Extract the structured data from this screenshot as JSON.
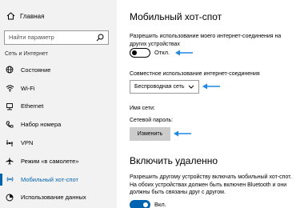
{
  "sidebar": {
    "home_label": "Главная",
    "search_placeholder": "Найти параметр",
    "section_title": "Сеть и Интернет",
    "items": [
      {
        "label": "Состояние",
        "icon": "globe-icon"
      },
      {
        "label": "Wi-Fi",
        "icon": "wifi-icon"
      },
      {
        "label": "Ethernet",
        "icon": "ethernet-icon"
      },
      {
        "label": "Набор номера",
        "icon": "phone-icon"
      },
      {
        "label": "VPN",
        "icon": "vpn-icon"
      },
      {
        "label": "Режим «в самолете»",
        "icon": "airplane-icon"
      },
      {
        "label": "Мобильный хот-спот",
        "icon": "hotspot-icon",
        "active": true
      },
      {
        "label": "Использование данных",
        "icon": "data-usage-icon"
      }
    ]
  },
  "main": {
    "title": "Мобильный хот-спот",
    "share_desc": "Разрешить использование моего интернет-соединения на других устройствах",
    "share_toggle_state": "Откл.",
    "share_from_label": "Совместное использование интернет-соединения",
    "share_from_value": "Беспроводная сеть",
    "network_name_label": "Имя сети:",
    "network_password_label": "Сетевой пароль:",
    "change_button": "Изменить",
    "remote_title": "Включить удаленно",
    "remote_desc": "Разрешить другому устройству включать мобильный хот-спот. На обоих устройствах должен быть включен Bluetooth и они должны быть связаны друг с другом.",
    "remote_toggle_state": "Вкл."
  },
  "colors": {
    "accent": "#0063b1",
    "annotation_arrow": "#1e88e5",
    "sidebar_bg": "#f2f2f2",
    "button_bg": "#cccccc"
  }
}
